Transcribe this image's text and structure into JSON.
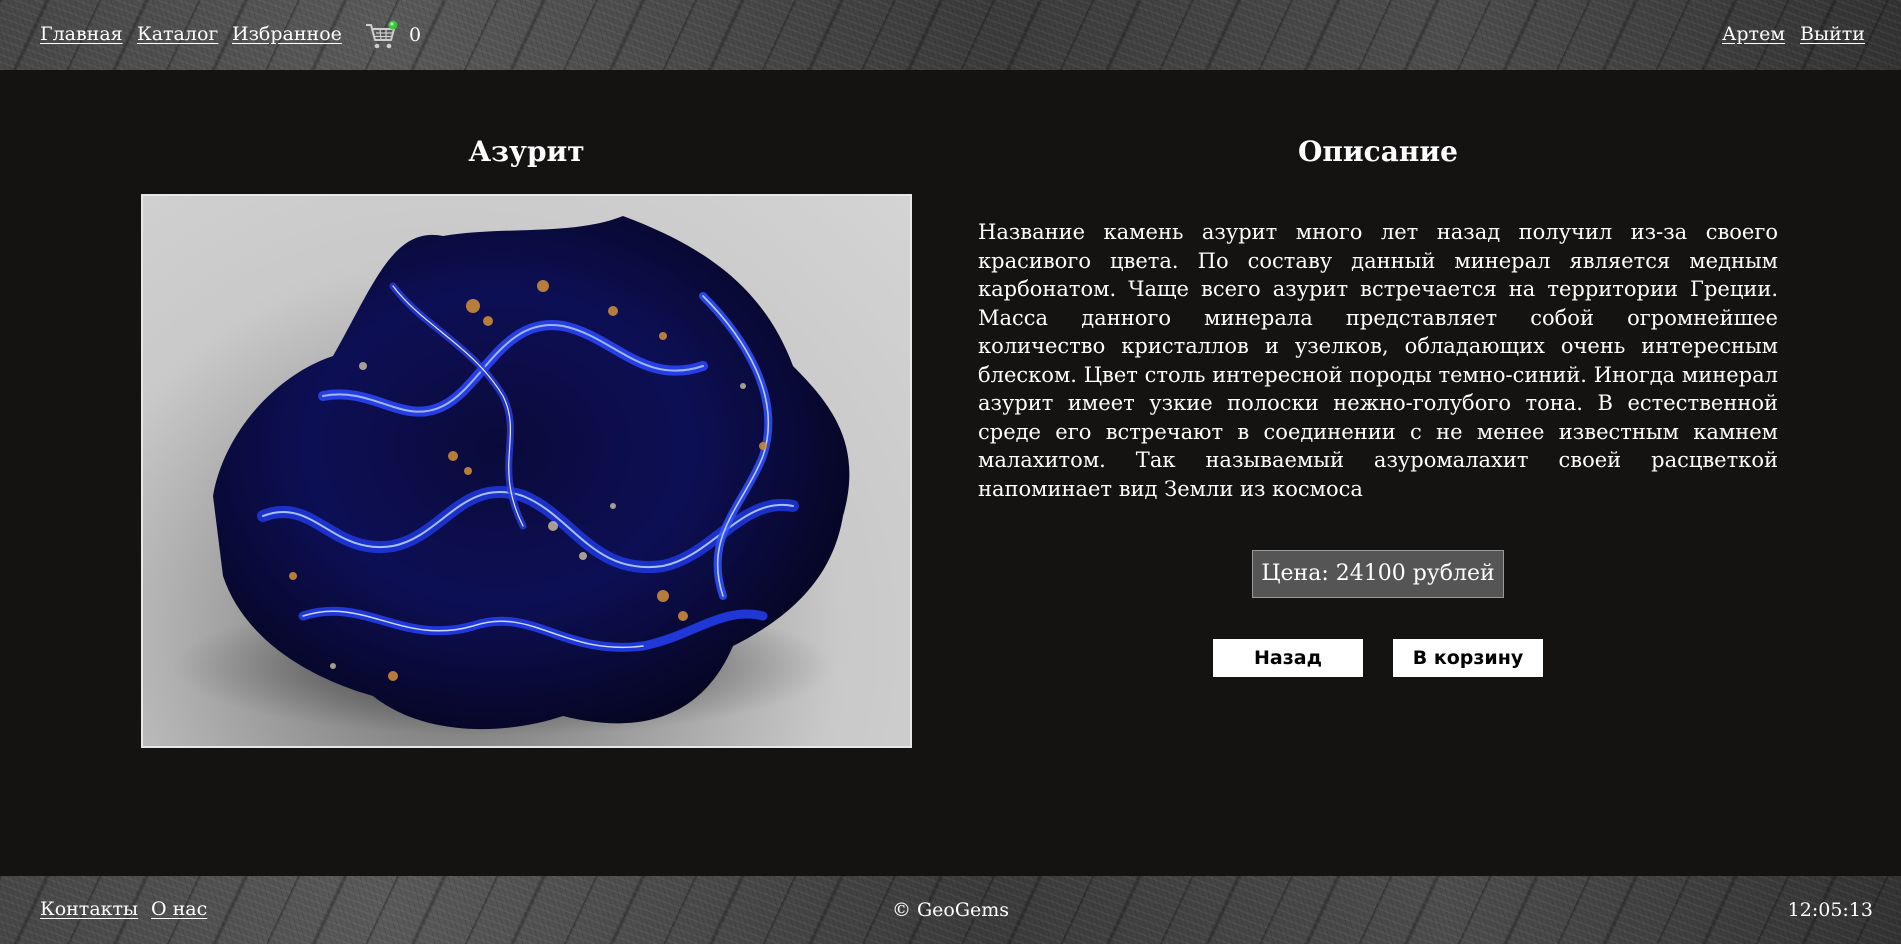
{
  "header": {
    "nav": {
      "home": "Главная",
      "catalog": "Каталог",
      "favorites": "Избранное"
    },
    "cart": {
      "icon": "cart-icon",
      "count": "0",
      "badge_color": "#3cc43c"
    },
    "user": {
      "name": "Артем",
      "logout": "Выйти"
    }
  },
  "product": {
    "title": "Азурит",
    "image_alt": "Азурит"
  },
  "description": {
    "title": "Описание",
    "text": "Название камень азурит много лет назад получил из-за своего красивого цвета. По составу данный минерал является медным карбонатом. Чаще всего азурит встречается на территории Греции. Масса данного минерала представляет собой огромнейшее количество кристаллов и узелков, обладающих очень интересным блеском. Цвет столь интересной породы темно-синий. Иногда минерал азурит имеет узкие полоски нежно-голубого тона. В естественной среде его встречают в соединении с не менее известным камнем малахитом. Так называемый азуромалахит своей расцветкой напоминает вид Земли из космоса",
    "price": "Цена: 24100 рублей"
  },
  "actions": {
    "back": "Назад",
    "add_to_cart": "В корзину"
  },
  "footer": {
    "contacts": "Контакты",
    "about": "О нас",
    "copyright": "© GeoGems",
    "time": "12:05:13"
  },
  "colors": {
    "background": "#151212",
    "price_box": "#555555",
    "button_bg": "#ffffff"
  }
}
